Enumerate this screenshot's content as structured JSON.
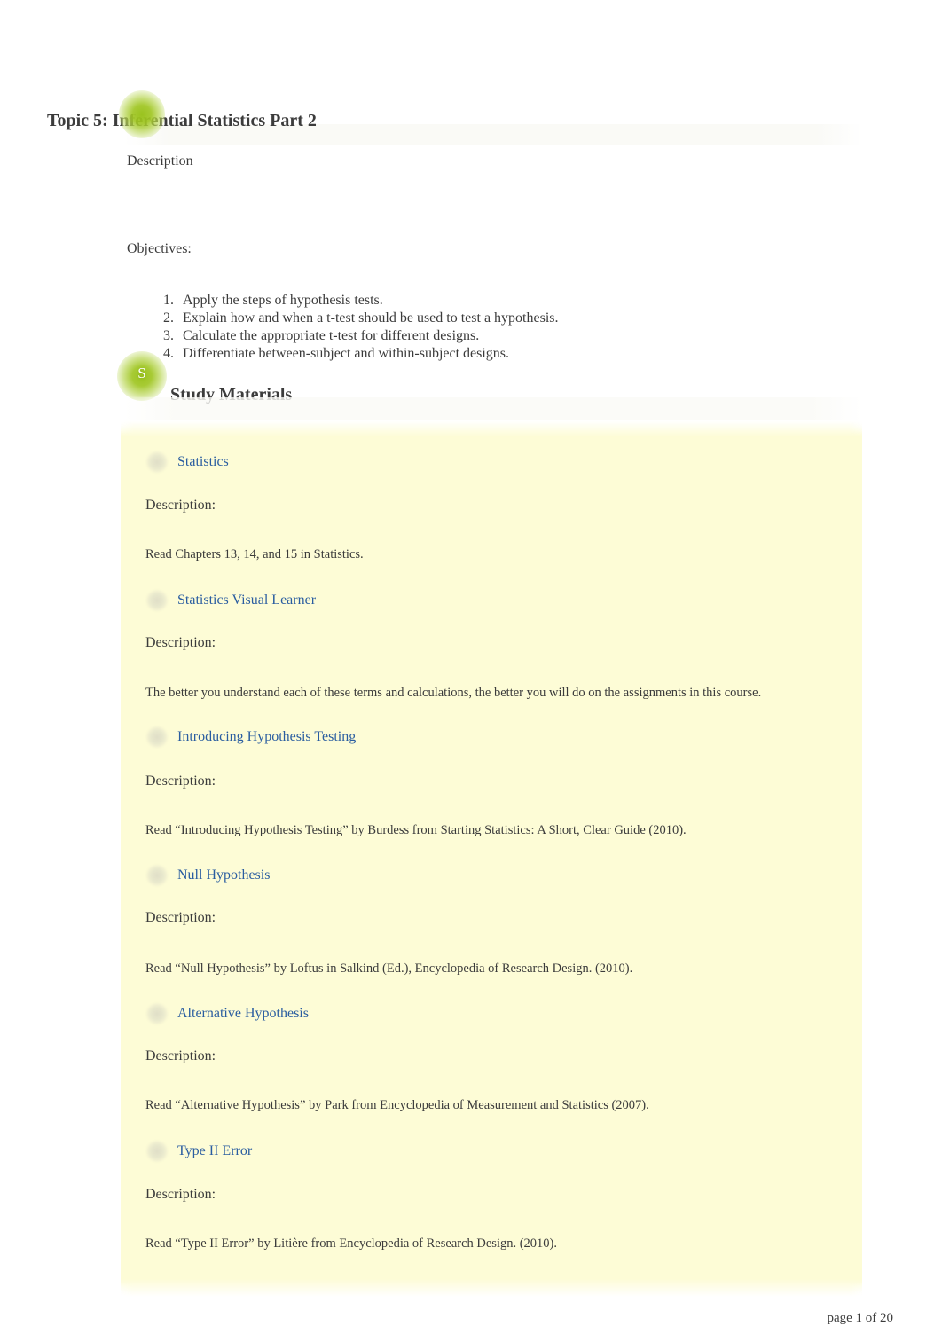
{
  "document": {
    "title": "Topic 5: Inferential Statistics Part 2",
    "description_label": "Description",
    "objectives_label": "Objectives:",
    "objectives": [
      "Apply the steps of hypothesis tests.",
      "Explain how and when a t-test should be used to test a hypothesis.",
      "Calculate the appropriate t-test for different designs.",
      "Differentiate between-subject and within-subject designs."
    ],
    "study_materials_heading": "Study Materials",
    "marker_letter": "S",
    "footer": "page 1 of 20"
  },
  "colors": {
    "link": "#2a5da0",
    "panel_background": "#fdfcd6",
    "highlight_green": "#96c016",
    "body_text": "#3b3b3b"
  },
  "study_materials": [
    {
      "title": "Statistics",
      "icon": "document-circle-icon",
      "description_label": "Description:",
      "description": "Read Chapters 13, 14, and 15 in Statistics."
    },
    {
      "title": "Statistics Visual Learner",
      "icon": "document-circle-icon",
      "description_label": "Description:",
      "description": "The better you understand each of these terms and calculations, the better you will do on the assignments in this course."
    },
    {
      "title": "Introducing Hypothesis Testing",
      "icon": "document-circle-icon",
      "description_label": "Description:",
      "description": "Read “Introducing Hypothesis Testing” by Burdess from  Starting Statistics: A Short, Clear Guide (2010)."
    },
    {
      "title": "Null Hypothesis",
      "icon": "document-circle-icon",
      "description_label": "Description:",
      "description": "Read “Null Hypothesis” by Loftus in Salkind (Ed.), Encyclopedia of Research Design.  (2010)."
    },
    {
      "title": "Alternative Hypothesis",
      "icon": "document-circle-icon",
      "description_label": "Description:",
      "description": "Read “Alternative Hypothesis” by Park from Encyclopedia of Measurement and Statistics (2007)."
    },
    {
      "title": "Type II Error",
      "icon": "document-circle-icon",
      "description_label": "Description:",
      "description": "Read “Type II Error” by Litière from Encyclopedia of Research Design.  (2010)."
    }
  ]
}
